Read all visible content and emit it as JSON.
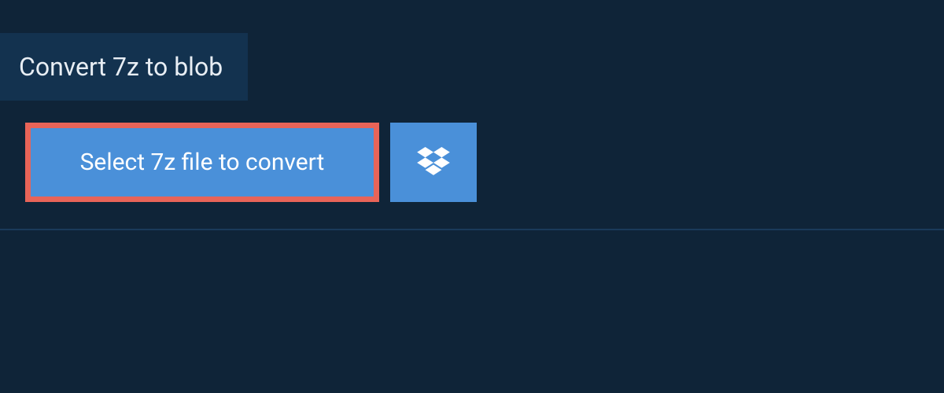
{
  "header": {
    "title": "Convert 7z to blob"
  },
  "actions": {
    "select_label": "Select 7z file to convert",
    "dropbox_icon": "dropbox"
  },
  "colors": {
    "background": "#0f2438",
    "tab_background": "#13324f",
    "button_blue": "#4a90d9",
    "highlight_border": "#e86458",
    "text_light": "#e8eef4"
  }
}
